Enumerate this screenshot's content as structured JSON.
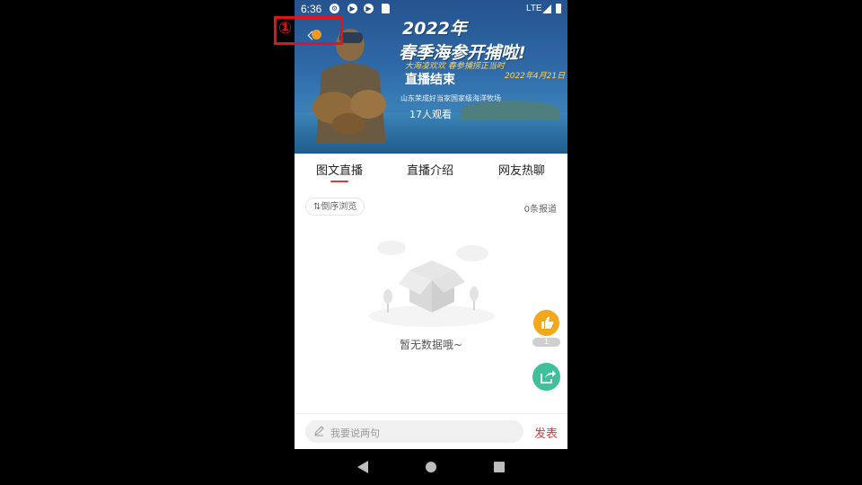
{
  "status_bar": {
    "time": "6:36",
    "network": "LTE"
  },
  "banner": {
    "headline_year": "2022年",
    "headline_title": "春季海参开捕啦!",
    "subtitle": "大海凌欢欢 春参捕捞正当时",
    "date": "2022年4月21日",
    "live_status": "直播结束",
    "venue": "山东荣成好当家国家级海洋牧场",
    "viewers": "17人观看"
  },
  "annotation": {
    "number": "①"
  },
  "tabs": [
    {
      "label": "图文直播",
      "active": true
    },
    {
      "label": "直播介绍",
      "active": false
    },
    {
      "label": "网友热聊",
      "active": false
    }
  ],
  "feed": {
    "sort_label": "倒序浏览",
    "report_count": "0条报道",
    "empty_text": "暂无数据哦~"
  },
  "actions": {
    "like_count": "1"
  },
  "comment": {
    "placeholder": "我要说两句",
    "publish_label": "发表"
  },
  "colors": {
    "accent": "#e4393c",
    "like": "#f2a81d",
    "share": "#3fbf9a",
    "annotation": "#e4131a"
  }
}
